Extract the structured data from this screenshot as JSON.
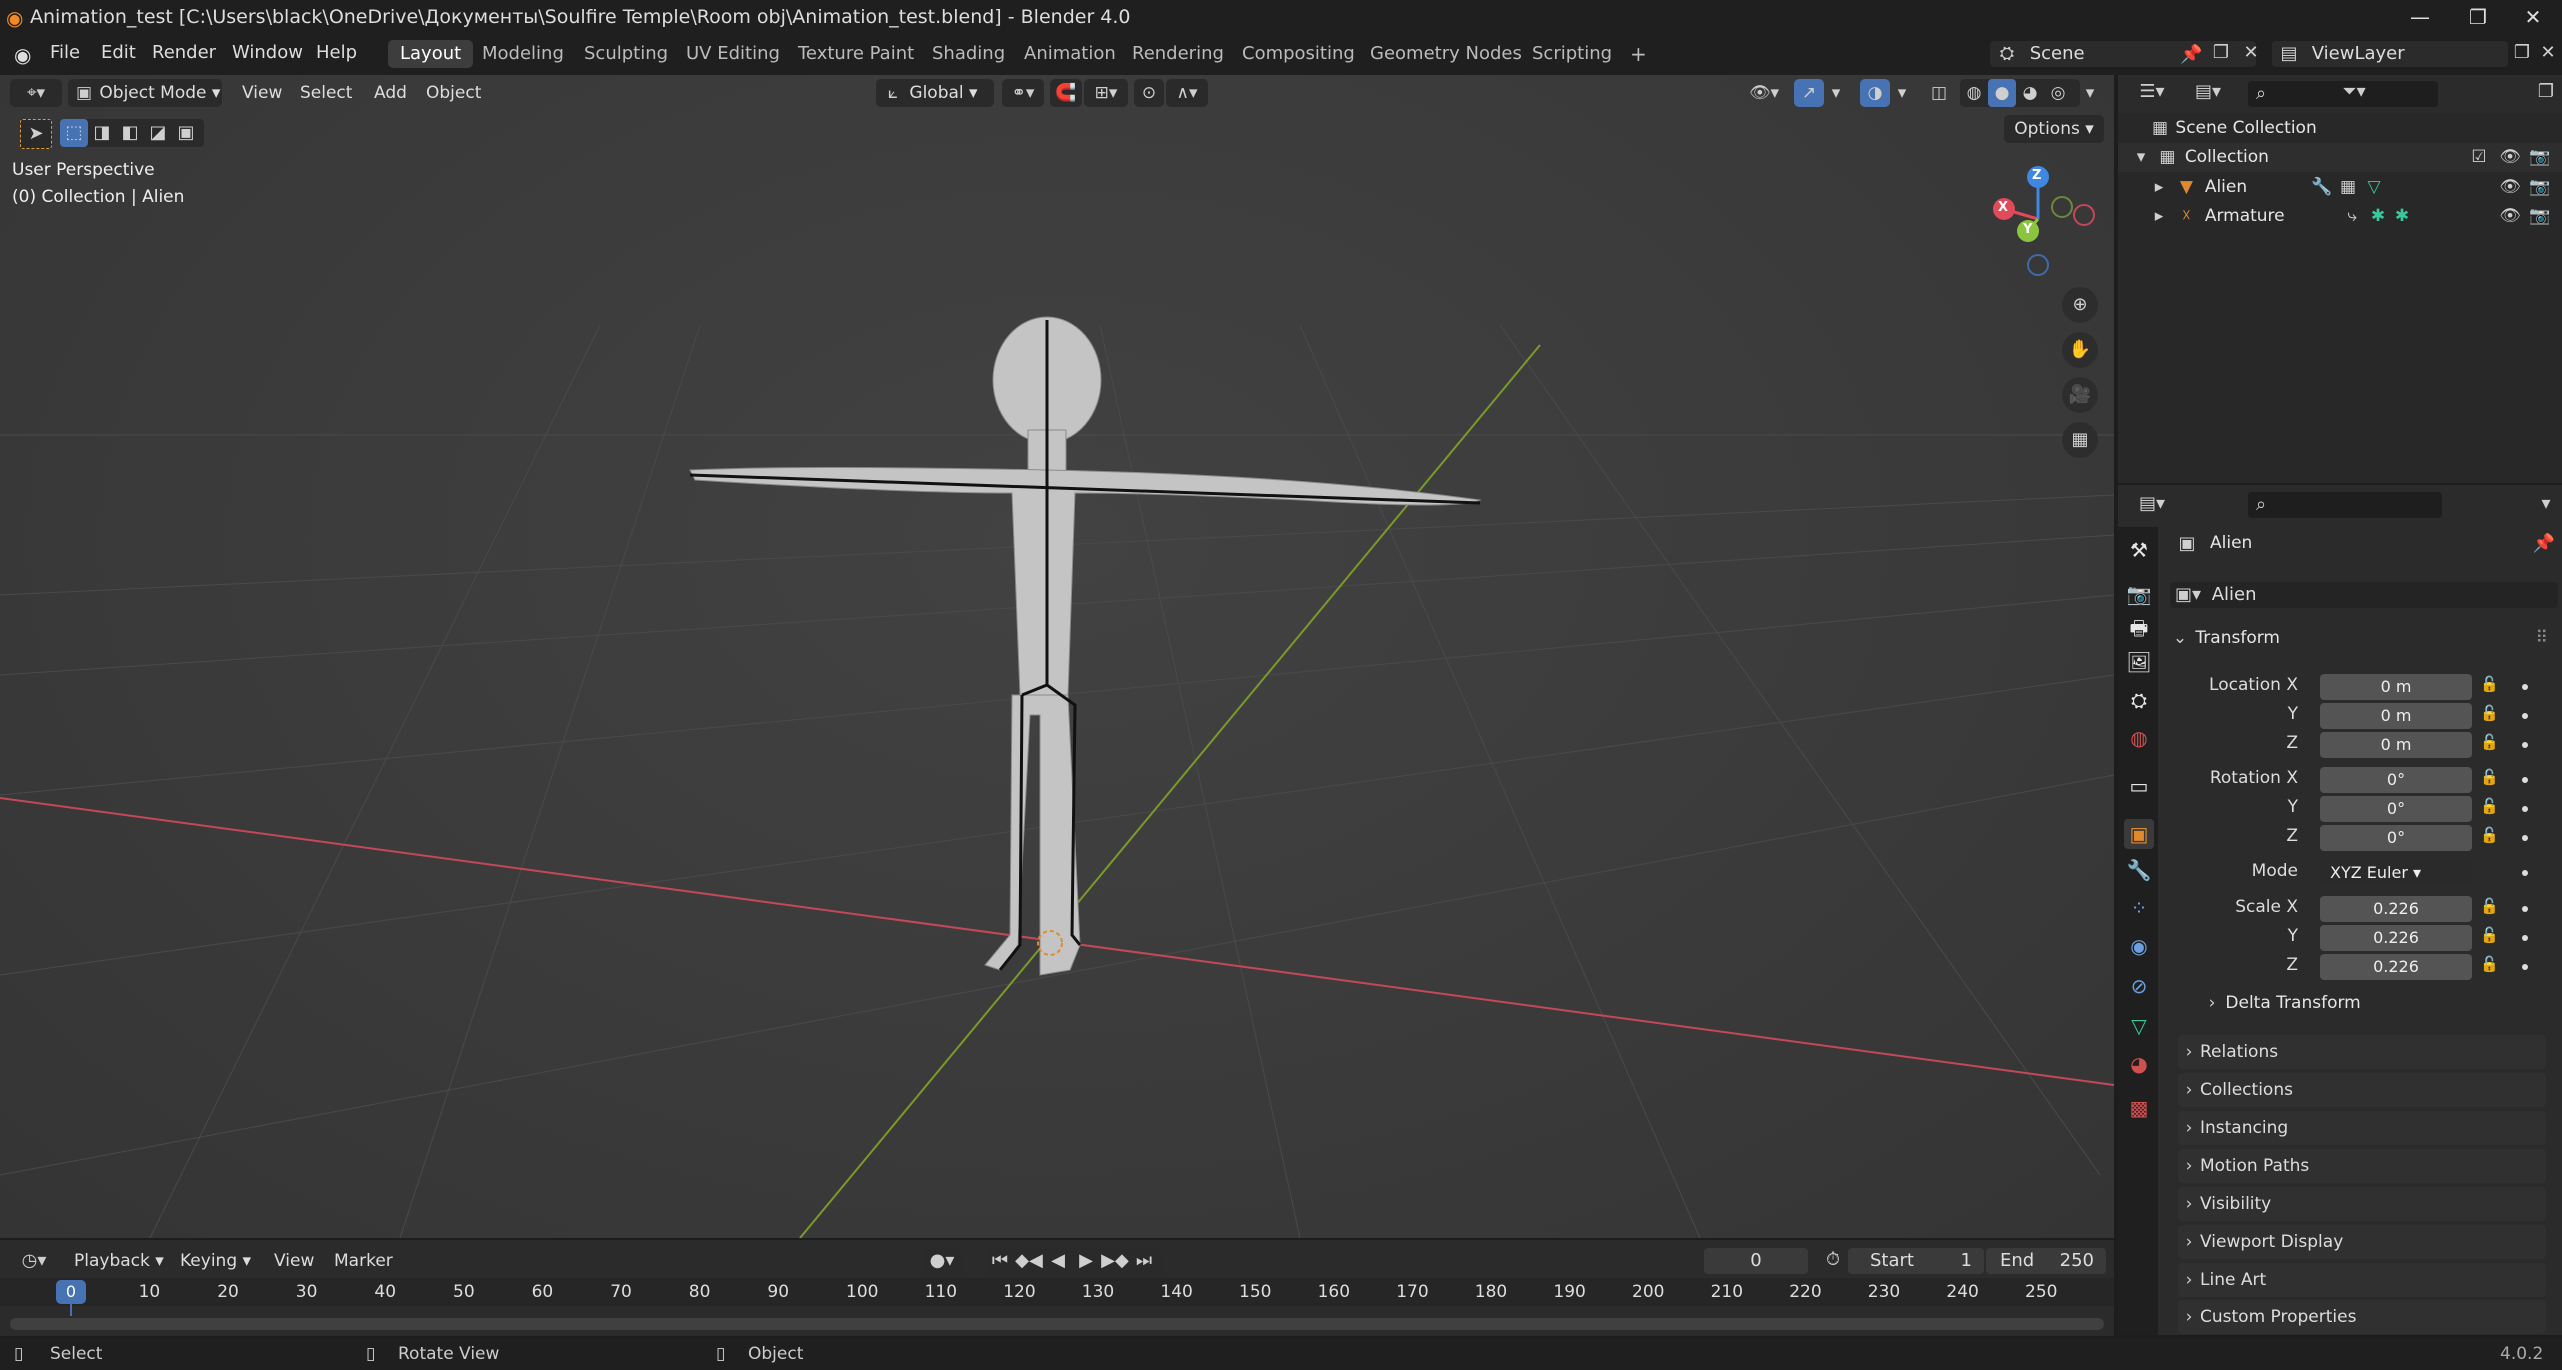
{
  "window": {
    "title": "Animation_test [C:\\Users\\black\\OneDrive\\Документы\\Soulfire Temple\\Room obj\\Animation_test.blend] - Blender 4.0",
    "minimize": "—",
    "maximize": "❐",
    "close": "✕"
  },
  "menu": [
    "File",
    "Edit",
    "Render",
    "Window",
    "Help"
  ],
  "workspaces": [
    "Layout",
    "Modeling",
    "Sculpting",
    "UV Editing",
    "Texture Paint",
    "Shading",
    "Animation",
    "Rendering",
    "Compositing",
    "Geometry Nodes",
    "Scripting"
  ],
  "active_workspace": "Layout",
  "scene": {
    "name": "Scene",
    "view_layer": "ViewLayer",
    "add_tab": "+"
  },
  "viewport": {
    "mode": "Object Mode",
    "menus": [
      "View",
      "Select",
      "Add",
      "Object"
    ],
    "orientation": "Global",
    "options_label": "Options",
    "perspective_label": "User Perspective",
    "collection_label": "(0) Collection | Alien",
    "gizmo_axes": {
      "z": "Z",
      "y": "Y",
      "x": "X"
    }
  },
  "outliner": {
    "scene_collection": "Scene Collection",
    "collection": "Collection",
    "items": [
      "Alien",
      "Armature"
    ]
  },
  "properties": {
    "object_name": "Alien",
    "datablock": "Alien",
    "transform_header": "Transform",
    "location_label": "Location X",
    "rotation_label": "Rotation X",
    "scale_label": "Scale X",
    "axis_y": "Y",
    "axis_z": "Z",
    "location": [
      "0 m",
      "0 m",
      "0 m"
    ],
    "rotation": [
      "0°",
      "0°",
      "0°"
    ],
    "mode_label": "Mode",
    "mode_value": "XYZ Euler",
    "scale": [
      "0.226",
      "0.226",
      "0.226"
    ],
    "delta_transform": "Delta Transform",
    "panels": [
      "Relations",
      "Collections",
      "Instancing",
      "Motion Paths",
      "Visibility",
      "Viewport Display",
      "Line Art",
      "Custom Properties"
    ]
  },
  "timeline": {
    "menus": [
      "Playback",
      "Keying",
      "View",
      "Marker"
    ],
    "current_frame": "0",
    "start_label": "Start",
    "start_value": "1",
    "end_label": "End",
    "end_value": "250",
    "ticks": [
      "0",
      "10",
      "20",
      "30",
      "40",
      "50",
      "60",
      "70",
      "80",
      "90",
      "100",
      "110",
      "120",
      "130",
      "140",
      "150",
      "160",
      "170",
      "180",
      "190",
      "200",
      "210",
      "220",
      "230",
      "240",
      "250"
    ]
  },
  "statusbar": {
    "select": "Select",
    "rotate": "Rotate View",
    "object": "Object",
    "version": "4.0.2"
  },
  "colors": {
    "accent": "#4772b3",
    "x_axis": "#e04a5a",
    "y_axis": "#8bc540",
    "z_axis": "#3f87e0",
    "object_orange": "#e08a2e"
  }
}
